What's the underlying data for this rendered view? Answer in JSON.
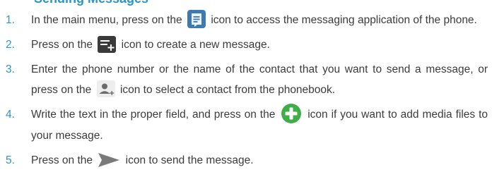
{
  "header": {
    "partial_title": "Sending Messages"
  },
  "colors": {
    "accent": "#2a95c7",
    "text": "#3c3c3c",
    "messaging_icon_bg": "#3f79b3",
    "compose_icon_bg": "#3a3a3a",
    "add_icon_green": "#3fae49",
    "send_icon_gray": "#7a7a7a"
  },
  "steps": [
    {
      "number": "1.",
      "before": "In the main menu, press on the",
      "icon": "messaging-app-icon",
      "after": "icon to access the messaging application of the phone."
    },
    {
      "number": "2.",
      "before": "Press on the",
      "icon": "compose-message-icon",
      "after": "icon to create a new message."
    },
    {
      "number": "3.",
      "before": "Enter the phone number or the name of the contact that you want to send a message, or press on the",
      "icon": "add-contact-icon",
      "after": "icon to select a contact from the phonebook."
    },
    {
      "number": "4.",
      "before": "Write the text in the proper field, and press on the",
      "icon": "add-attachment-icon",
      "after": "icon if you want to add media files to your message."
    },
    {
      "number": "5.",
      "before": "Press on the",
      "icon": "send-icon",
      "after": "icon to send the message."
    }
  ]
}
